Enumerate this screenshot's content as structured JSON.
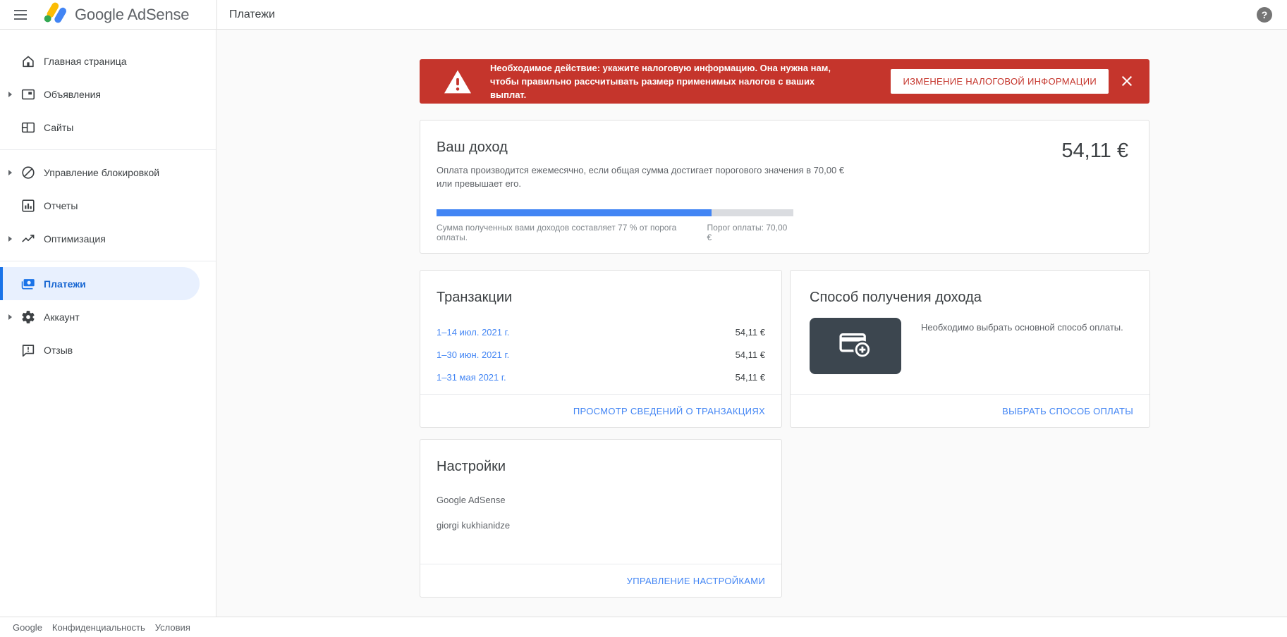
{
  "header": {
    "brand_google": "Google",
    "brand_product": "AdSense",
    "page_title": "Платежи",
    "help_glyph": "?"
  },
  "sidebar": {
    "items": [
      {
        "label": "Главная страница",
        "icon": "home-icon",
        "expandable": false,
        "selected": false
      },
      {
        "label": "Объявления",
        "icon": "ads-icon",
        "expandable": true,
        "selected": false
      },
      {
        "label": "Сайты",
        "icon": "sites-icon",
        "expandable": false,
        "selected": false
      },
      {
        "label": "Управление блокировкой",
        "icon": "block-icon",
        "expandable": true,
        "selected": false
      },
      {
        "label": "Отчеты",
        "icon": "reports-icon",
        "expandable": false,
        "selected": false
      },
      {
        "label": "Оптимизация",
        "icon": "trending-up-icon",
        "expandable": true,
        "selected": false
      },
      {
        "label": "Платежи",
        "icon": "payments-icon",
        "expandable": false,
        "selected": true
      },
      {
        "label": "Аккаунт",
        "icon": "gear-icon",
        "expandable": true,
        "selected": false
      },
      {
        "label": "Отзыв",
        "icon": "feedback-icon",
        "expandable": false,
        "selected": false
      }
    ],
    "footer": {
      "brand": "Google",
      "privacy": "Конфиденциальность",
      "terms": "Условия"
    }
  },
  "alert": {
    "text": "Необходимое действие: укажите налоговую информацию. Она нужна нам, чтобы правильно рассчитывать размер применимых налогов с ваших выплат.",
    "button_label": "ИЗМЕНЕНИЕ НАЛОГОВОЙ ИНФОРМАЦИИ"
  },
  "income_card": {
    "title": "Ваш доход",
    "description": "Оплата производится ежемесячно, если общая сумма достигает порогового значения в 70,00 € или превышает его.",
    "amount": "54,11 €",
    "progress_percent": 77,
    "progress_label": "Сумма полученных вами доходов составляет 77 % от порога оплаты.",
    "threshold_label": "Порог оплаты: 70,00 €"
  },
  "transactions_card": {
    "title": "Транзакции",
    "rows": [
      {
        "period": "1–14 июл. 2021 г.",
        "amount": "54,11 €"
      },
      {
        "period": "1–30 июн. 2021 г.",
        "amount": "54,11 €"
      },
      {
        "period": "1–31 мая 2021 г.",
        "amount": "54,11 €"
      }
    ],
    "action_label": "ПРОСМОТР СВЕДЕНИЙ О ТРАНЗАКЦИЯХ"
  },
  "payment_method_card": {
    "title": "Способ получения дохода",
    "message": "Необходимо выбрать основной способ оплаты.",
    "action_label": "ВЫБРАТЬ СПОСОБ ОПЛАТЫ"
  },
  "settings_card": {
    "title": "Настройки",
    "line_product": "Google AdSense",
    "line_user": "giorgi kukhianidze",
    "action_label": "УПРАВЛЕНИЕ НАСТРОЙКАМИ"
  },
  "colors": {
    "accent_blue": "#4285f4",
    "selected_blue": "#1967d2",
    "alert_red": "#c5352c",
    "tile_dark": "#3c464f"
  }
}
